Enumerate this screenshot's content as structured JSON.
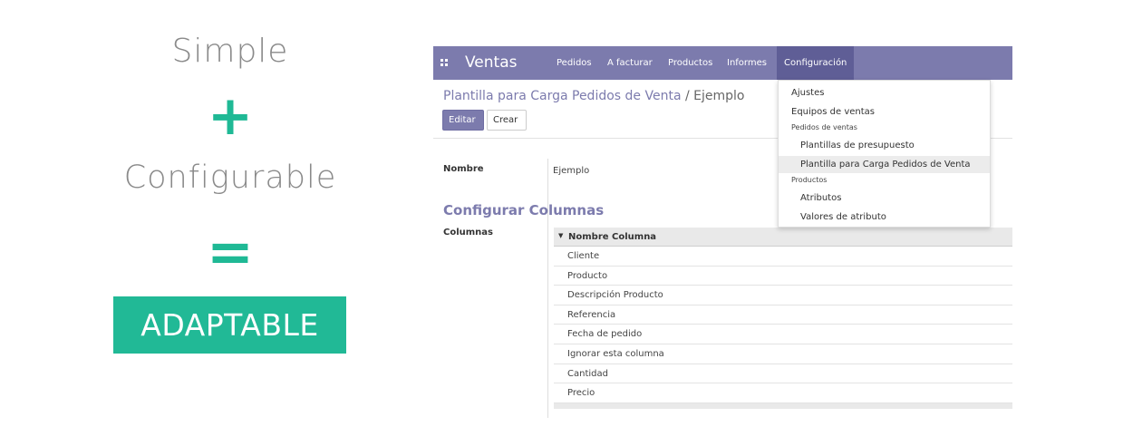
{
  "promo": {
    "line1": "Simple",
    "plus": "+",
    "line2": "Configurable",
    "equals": "=",
    "result": "ADAPTABLE",
    "accent_color": "#21b996"
  },
  "navbar": {
    "app_icon": "apps-grid-icon",
    "brand": "Ventas",
    "menu": [
      "Pedidos",
      "A facturar",
      "Productos",
      "Informes"
    ],
    "active_menu": "Configuración",
    "color": "#7c7bad"
  },
  "dropdown": {
    "items": [
      {
        "label": "Ajustes",
        "type": "item"
      },
      {
        "label": "Equipos de ventas",
        "type": "item"
      },
      {
        "label": "Pedidos de ventas",
        "type": "header"
      },
      {
        "label": "Plantillas de presupuesto",
        "type": "sub"
      },
      {
        "label": "Plantilla para Carga Pedidos de Venta",
        "type": "sub",
        "active": true
      },
      {
        "label": "Productos",
        "type": "header"
      },
      {
        "label": "Atributos",
        "type": "sub"
      },
      {
        "label": "Valores de atributo",
        "type": "sub"
      }
    ]
  },
  "breadcrumb": {
    "parent": "Plantilla para Carga Pedidos de Venta",
    "separator": " / ",
    "current": "Ejemplo"
  },
  "buttons": {
    "edit": "Editar",
    "create": "Crear"
  },
  "form": {
    "name_label": "Nombre",
    "name_value": "Ejemplo",
    "section_title": "Configurar Columnas",
    "columns_label": "Columnas",
    "table_header": "Nombre Columna",
    "rows": [
      "Cliente",
      "Producto",
      "Descripción Producto",
      "Referencia",
      "Fecha de pedido",
      "Ignorar esta columna",
      "Cantidad",
      "Precio"
    ]
  }
}
